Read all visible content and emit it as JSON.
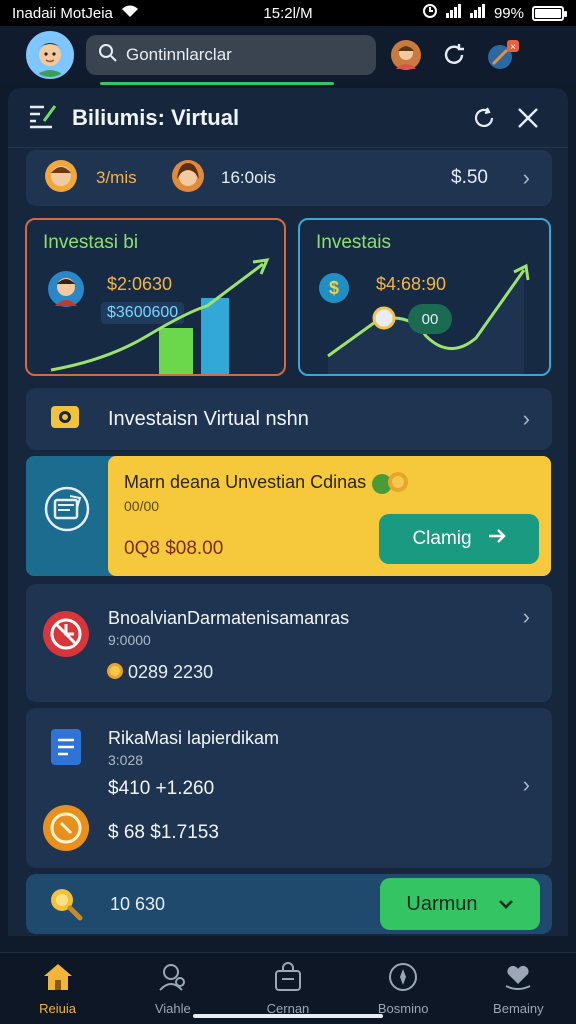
{
  "status_bar": {
    "carrier": "Inadaii MotJeia",
    "time": "15:2l/M",
    "battery": "99%",
    "battery_level": 0.99
  },
  "top_bar": {
    "search_placeholder": "Gontinnlarclar"
  },
  "sheet": {
    "title": "Biliumis: Virtual"
  },
  "summary_row": {
    "name": "3/mis",
    "time": "16:0ois",
    "amount": "$.50"
  },
  "stat_left": {
    "title": "Investasi bi",
    "value1": "$2:0630",
    "value2": "$3600600"
  },
  "stat_right": {
    "title": "Investais",
    "value1": "$4:68:90",
    "badge": "00"
  },
  "section_header": {
    "label": "Investaisn Virtual nshn"
  },
  "promo": {
    "title": "Marn deana Unvestian Cdinas",
    "subtitle": "00/00",
    "amount": "0Q8 $08.00",
    "button_label": "Clamig"
  },
  "item1": {
    "title": "BnoalvianDarmatenisamanras",
    "subtitle": "9:0000",
    "value": "0289 2230"
  },
  "item2": {
    "title": "RikaMasi lapierdikam",
    "subtitle": "3:028",
    "value1": "$410 +1.260",
    "value2": "$ 68 $1.7153"
  },
  "footer_bar": {
    "value": "10 630",
    "button_label": "Uarmun"
  },
  "bottom_nav": [
    {
      "label": "Reiuia",
      "icon": "home-icon"
    },
    {
      "label": "Viahle",
      "icon": "user-search-icon"
    },
    {
      "label": "Cernan",
      "icon": "bag-icon"
    },
    {
      "label": "Bosmino",
      "icon": "compass-icon"
    },
    {
      "label": "Bemainy",
      "icon": "heart-hand-icon"
    }
  ],
  "colors": {
    "accent_green": "#34c463",
    "accent_yellow": "#f6c93c",
    "accent_teal": "#1a9a80",
    "card_bg": "#1f3450"
  }
}
